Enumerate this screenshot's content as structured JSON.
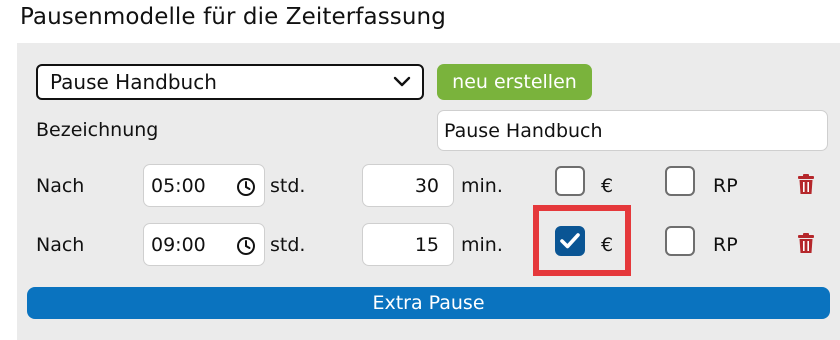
{
  "page": {
    "title": "Pausenmodelle für die Zeiterfassung"
  },
  "model_select": {
    "value": "Pause Handbuch"
  },
  "buttons": {
    "create": "neu erstellen",
    "extra_pause": "Extra Pause"
  },
  "designation": {
    "label": "Bezeichnung",
    "value": "Pause Handbuch"
  },
  "rows": [
    {
      "prefix": "Nach",
      "time": "05:00",
      "hours_unit": "std.",
      "minutes": "30",
      "minutes_unit": "min.",
      "euro_label": "€",
      "euro_checked": false,
      "rp_label": "RP",
      "rp_checked": false
    },
    {
      "prefix": "Nach",
      "time": "09:00",
      "hours_unit": "std.",
      "minutes": "15",
      "minutes_unit": "min.",
      "euro_label": "€",
      "euro_checked": true,
      "rp_label": "RP",
      "rp_checked": false
    }
  ],
  "colors": {
    "accent_green": "#7ab33c",
    "accent_blue": "#0a73bf",
    "checkbox_checked": "#0a5594",
    "delete_icon": "#b5272b",
    "highlight": "#e5383b"
  }
}
